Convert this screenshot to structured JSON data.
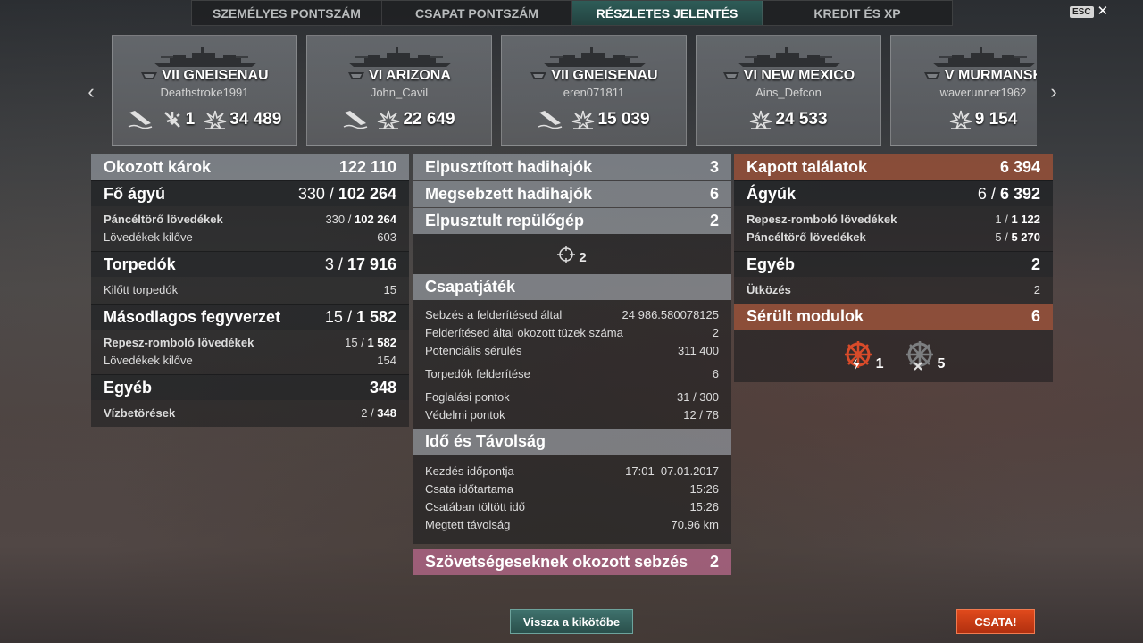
{
  "tabs": [
    {
      "label": "SZEMÉLYES PONTSZÁM"
    },
    {
      "label": "CSAPAT PONTSZÁM"
    },
    {
      "label": "RÉSZLETES JELENTÉS"
    },
    {
      "label": "KREDIT ÉS XP"
    }
  ],
  "active_tab": "RÉSZLETES JELENTÉS",
  "esc": {
    "key": "ESC",
    "close": "✕"
  },
  "nav": {
    "prev": "‹",
    "next": "›"
  },
  "cards": [
    {
      "ship": "VII GNEISENAU",
      "player": "Deathstroke1991",
      "planes": "1",
      "damage": "34 489"
    },
    {
      "ship": "VI ARIZONA",
      "player": "John_Cavil",
      "damage": "22 649"
    },
    {
      "ship": "VII GNEISENAU",
      "player": "eren071811",
      "damage": "15 039"
    },
    {
      "ship": "VI NEW MEXICO",
      "player": "Ains_Defcon",
      "damage": "24 533"
    },
    {
      "ship": "V MURMANSK",
      "player": "waverunner1962",
      "damage": "9 154"
    }
  ],
  "left": {
    "damage": {
      "label": "Okozott károk",
      "value": "122 110"
    },
    "main_battery": {
      "label": "Fő ágyú",
      "hits": "330",
      "dmg": "102 264"
    },
    "ap": {
      "label": "Páncéltörő lövedékek",
      "hits": "330",
      "dmg": "102 264"
    },
    "shells_fired": {
      "label": "Lövedékek kilőve",
      "value": "603"
    },
    "torpedoes": {
      "label": "Torpedók",
      "hits": "3",
      "dmg": "17 916"
    },
    "torps_fired": {
      "label": "Kilőtt torpedók",
      "value": "15"
    },
    "secondary": {
      "label": "Másodlagos fegyverzet",
      "hits": "15",
      "dmg": "1 582"
    },
    "he": {
      "label": "Repesz-romboló lövedékek",
      "hits": "15",
      "dmg": "1 582"
    },
    "sec_fired": {
      "label": "Lövedékek kilőve",
      "value": "154"
    },
    "other": {
      "label": "Egyéb",
      "value": "348"
    },
    "flooding": {
      "label": "Vízbetörések",
      "hits": "2",
      "dmg": "348"
    }
  },
  "center": {
    "destroyed": {
      "label": "Elpusztított hadihajók",
      "value": "3"
    },
    "damaged": {
      "label": "Megsebzett hadihajók",
      "value": "6"
    },
    "planes": {
      "label": "Elpusztult repülőgép",
      "value": "2"
    },
    "crosshair_count": "2",
    "teamplay": {
      "label": "Csapatjáték"
    },
    "spotting_dmg": {
      "label": "Sebzés a felderítésed által",
      "value": "24 986.580078125"
    },
    "spotting_fires": {
      "label": "Felderítésed által okozott tüzek száma",
      "value": "2"
    },
    "potential": {
      "label": "Potenciális sérülés",
      "value": "311 400"
    },
    "torp_spot": {
      "label": "Torpedók felderítése",
      "value": "6"
    },
    "capture": {
      "label": "Foglalási pontok",
      "value": "31 / 300"
    },
    "defense": {
      "label": "Védelmi pontok",
      "value": "12 / 78"
    },
    "time": {
      "label": "Idő és Távolság"
    },
    "start": {
      "label": "Kezdés időpontja",
      "value": "17:01  07.01.2017"
    },
    "duration": {
      "label": "Csata időtartama",
      "value": "15:26"
    },
    "time_spent": {
      "label": "Csatában töltött idő",
      "value": "15:26"
    },
    "distance": {
      "label": "Megtett távolság",
      "value": "70.96 km"
    },
    "team_damage": {
      "label": "Szövetségeseknek okozott sebzés",
      "value": "2"
    }
  },
  "right": {
    "received": {
      "label": "Kapott találatok",
      "value": "6 394"
    },
    "guns": {
      "label": "Ágyúk",
      "hits": "6",
      "dmg": "6 392"
    },
    "he": {
      "label": "Repesz-romboló lövedékek",
      "hits": "1",
      "dmg": "1 122"
    },
    "ap": {
      "label": "Páncéltörő lövedékek",
      "hits": "5",
      "dmg": "5 270"
    },
    "other": {
      "label": "Egyéb",
      "value": "2"
    },
    "ramming": {
      "label": "Ütközés",
      "value": "2"
    },
    "modules": {
      "label": "Sérült modulok",
      "value": "6"
    },
    "mod_damaged": "1",
    "mod_destroyed": "5"
  },
  "buttons": {
    "port": "Vissza a kikötőbe",
    "battle": "CSATA!"
  },
  "colors": {
    "accent_teal": "#2e5d58",
    "battle_red": "#d33f16",
    "received_red": "#965038",
    "team_pink": "#ac6482"
  }
}
